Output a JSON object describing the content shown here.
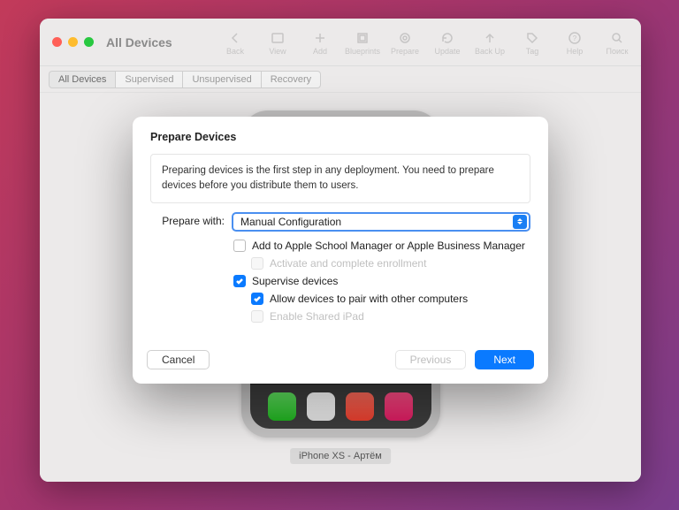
{
  "window": {
    "title": "All Devices"
  },
  "toolbar": {
    "items": [
      {
        "name": "back",
        "label": "Back"
      },
      {
        "name": "view",
        "label": "View"
      },
      {
        "name": "add",
        "label": "Add"
      },
      {
        "name": "blueprints",
        "label": "Blueprints"
      },
      {
        "name": "prepare",
        "label": "Prepare"
      },
      {
        "name": "update",
        "label": "Update"
      },
      {
        "name": "backup",
        "label": "Back Up"
      },
      {
        "name": "tag",
        "label": "Tag"
      },
      {
        "name": "help",
        "label": "Help"
      },
      {
        "name": "search",
        "label": "Поиск"
      }
    ]
  },
  "filters": {
    "items": [
      {
        "label": "All Devices",
        "active": true
      },
      {
        "label": "Supervised",
        "active": false
      },
      {
        "label": "Unsupervised",
        "active": false
      },
      {
        "label": "Recovery",
        "active": false
      }
    ]
  },
  "device": {
    "label": "iPhone XS - Артём"
  },
  "modal": {
    "title": "Prepare Devices",
    "intro": "Preparing devices is the first step in any deployment. You need to prepare devices before you distribute them to users.",
    "prepare_with_label": "Prepare with:",
    "prepare_with_value": "Manual Configuration",
    "options": {
      "add_to_manager": {
        "label": "Add to Apple School Manager or Apple Business Manager",
        "checked": false,
        "disabled": false
      },
      "activate_enroll": {
        "label": "Activate and complete enrollment",
        "checked": false,
        "disabled": true
      },
      "supervise": {
        "label": "Supervise devices",
        "checked": true,
        "disabled": false
      },
      "allow_pair": {
        "label": "Allow devices to pair with other computers",
        "checked": true,
        "disabled": false
      },
      "shared_ipad": {
        "label": "Enable Shared iPad",
        "checked": false,
        "disabled": true
      }
    },
    "buttons": {
      "cancel": "Cancel",
      "previous": "Previous",
      "next": "Next"
    }
  }
}
